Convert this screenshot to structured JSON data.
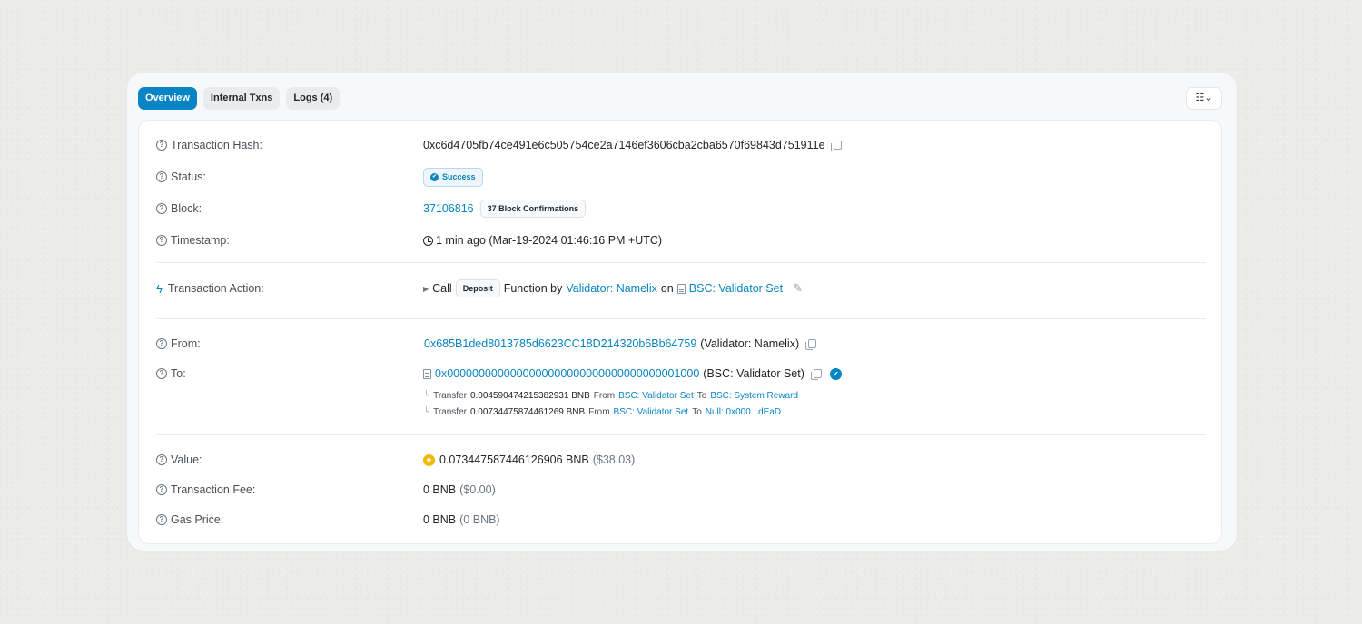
{
  "tabs": [
    {
      "label": "Overview",
      "active": true
    },
    {
      "label": "Internal Txns",
      "active": false
    },
    {
      "label": "Logs (4)",
      "active": false
    }
  ],
  "view_toggle": {
    "icon": "list-settings-icon",
    "glyph": "☷⌄"
  },
  "fields": {
    "hash": {
      "label": "Transaction Hash:",
      "value": "0xc6d4705fb74ce491e6c505754ce2a7146ef3606cba2cba6570f69843d751911e"
    },
    "status": {
      "label": "Status:",
      "value": "Success"
    },
    "block": {
      "label": "Block:",
      "number": "37106816",
      "confirmations": "37 Block Confirmations"
    },
    "timestamp": {
      "label": "Timestamp:",
      "value": "1 min ago (Mar-19-2024 01:46:16 PM +UTC)"
    },
    "action": {
      "label": "Transaction Action:",
      "call": "Call",
      "method": "Deposit",
      "function_by": "Function by",
      "from_name": "Validator: Namelix",
      "on": "on",
      "contract": "BSC: Validator Set"
    },
    "from": {
      "label": "From:",
      "address": "0x685B1ded8013785d6623CC18D214320b6Bb64759",
      "name": "(Validator: Namelix)"
    },
    "to": {
      "label": "To:",
      "address": "0x0000000000000000000000000000000000001000",
      "name": "(BSC: Validator Set)"
    },
    "transfers": [
      {
        "word": "Transfer",
        "amount": "0.004590474215382931 BNB",
        "from_word": "From",
        "from": "BSC: Validator Set",
        "to_word": "To",
        "to": "BSC: System Reward"
      },
      {
        "word": "Transfer",
        "amount": "0.00734475874461269 BNB",
        "from_word": "From",
        "from": "BSC: Validator Set",
        "to_word": "To",
        "to": "Null: 0x000...dEaD"
      }
    ],
    "value": {
      "label": "Value:",
      "amount": "0.073447587446126906 BNB",
      "usd": "($38.03)"
    },
    "fee": {
      "label": "Transaction Fee:",
      "amount": "0 BNB",
      "usd": "($0.00)"
    },
    "gas": {
      "label": "Gas Price:",
      "amount": "0 BNB",
      "sub": "(0 BNB)"
    }
  },
  "colors": {
    "accent": "#0784c3",
    "bnb": "#f0b90b"
  }
}
